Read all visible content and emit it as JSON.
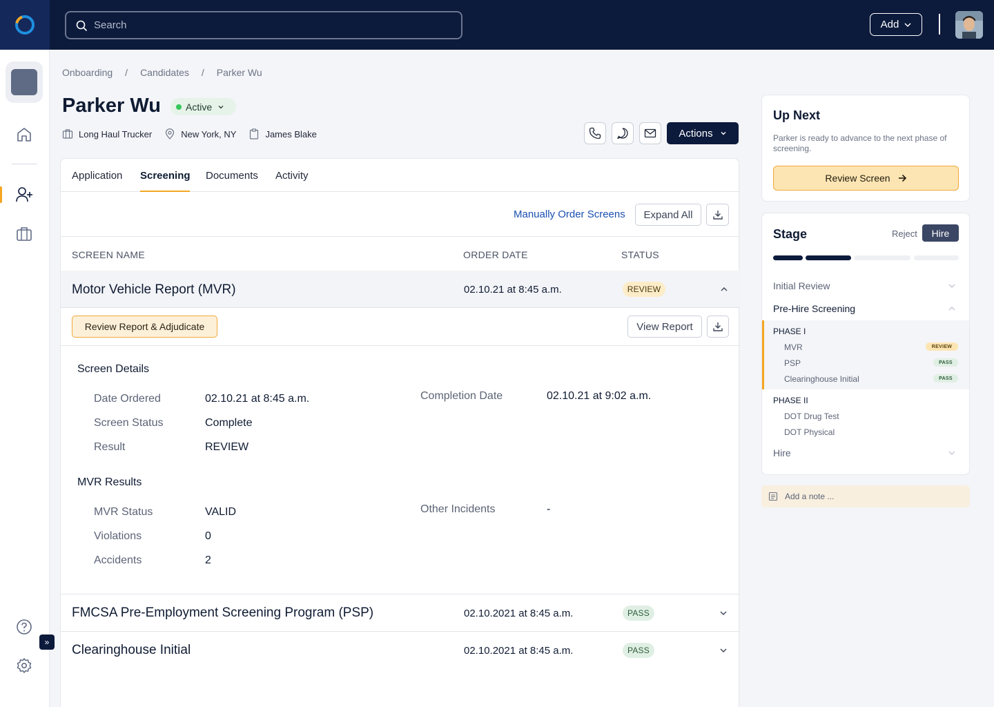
{
  "colors": {
    "navy": "#0c1a3c",
    "accent": "#f5a623",
    "link": "#1a4fb0",
    "success": "#34c759"
  },
  "header": {
    "search_placeholder": "Search",
    "add_label": "Add"
  },
  "sidebar": {
    "icons": [
      "home-icon",
      "user-plus-icon",
      "briefcase-icon",
      "help-icon",
      "gear-icon"
    ],
    "collapse_label": "»"
  },
  "breadcrumb": [
    "Onboarding",
    "Candidates",
    "Parker Wu"
  ],
  "breadcrumb_sep": "/",
  "candidate": {
    "name": "Parker Wu",
    "status": "Active",
    "role": "Long Haul Trucker",
    "location": "New York, NY",
    "recruiter": "James Blake"
  },
  "actions_label": "Actions",
  "tabs": [
    "Application",
    "Screening",
    "Documents",
    "Activity"
  ],
  "active_tab": "Screening",
  "toolbar": {
    "manual_order": "Manually Order Screens",
    "expand_all": "Expand All"
  },
  "columns": {
    "name": "SCREEN NAME",
    "date": "ORDER DATE",
    "status": "STATUS"
  },
  "screens": [
    {
      "name": "Motor Vehicle Report (MVR)",
      "date": "02.10.21 at 8:45 a.m.",
      "status": "REVIEW"
    },
    {
      "name": "FMCSA Pre-Employment Screening Program (PSP)",
      "date": "02.10.2021 at 8:45 a.m.",
      "status": "PASS"
    },
    {
      "name": "Clearinghouse Initial",
      "date": "02.10.2021 at 8:45 a.m.",
      "status": "PASS"
    }
  ],
  "mvr_detail": {
    "adjudicate_label": "Review Report & Adjudicate",
    "view_report_label": "View Report",
    "screen_details_title": "Screen Details",
    "details": [
      {
        "label": "Date Ordered",
        "value": "02.10.21 at 8:45 a.m."
      },
      {
        "label": "Screen Status",
        "value": "Complete"
      },
      {
        "label": "Result",
        "value": "REVIEW"
      }
    ],
    "completion": {
      "label": "Completion Date",
      "value": "02.10.21 at 9:02 a.m."
    },
    "results_title": "MVR Results",
    "results": [
      {
        "label": "MVR Status",
        "value": "VALID"
      },
      {
        "label": "Violations",
        "value": "0"
      },
      {
        "label": "Accidents",
        "value": "2"
      }
    ],
    "other": {
      "label": "Other Incidents",
      "value": "-"
    }
  },
  "up_next": {
    "title": "Up Next",
    "text": "Parker is ready to advance to the next phase of screening.",
    "button": "Review Screen"
  },
  "stage": {
    "title": "Stage",
    "reject": "Reject",
    "hire": "Hire",
    "progress_segments": [
      {
        "state": "complete"
      },
      {
        "state": "complete"
      },
      {
        "state": "pending"
      },
      {
        "state": "pending"
      }
    ],
    "items": [
      "Initial Review",
      "Pre-Hire Screening",
      "Hire"
    ],
    "phase1": {
      "title": "PHASE I",
      "items": [
        {
          "name": "MVR",
          "status": "REVIEW"
        },
        {
          "name": "PSP",
          "status": "PASS"
        },
        {
          "name": "Clearinghouse Initial",
          "status": "PASS"
        }
      ]
    },
    "phase2": {
      "title": "PHASE II",
      "items": [
        "DOT Drug Test",
        "DOT Physical"
      ]
    }
  },
  "note_placeholder": "Add a note ..."
}
